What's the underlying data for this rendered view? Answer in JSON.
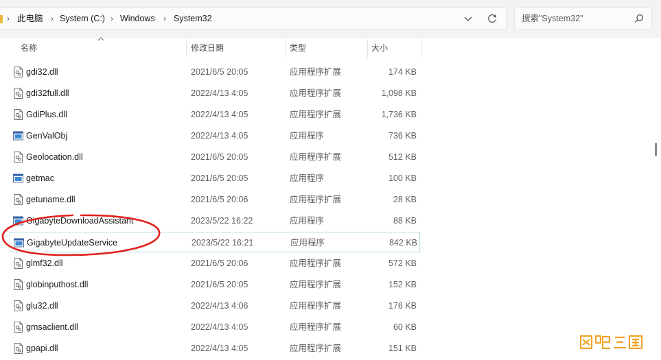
{
  "address_bar": {
    "crumbs": [
      "此电脑",
      "System (C:)",
      "Windows",
      "System32"
    ]
  },
  "search": {
    "placeholder": "搜索\"System32\""
  },
  "columns": {
    "name": "名称",
    "date": "修改日期",
    "type": "类型",
    "size": "大小"
  },
  "files": [
    {
      "name": "gdi32.dll",
      "date": "2021/6/5 20:05",
      "type": "应用程序扩展",
      "size": "174 KB",
      "icon": "dll-file-icon"
    },
    {
      "name": "gdi32full.dll",
      "date": "2022/4/13 4:05",
      "type": "应用程序扩展",
      "size": "1,098 KB",
      "icon": "dll-file-icon"
    },
    {
      "name": "GdiPlus.dll",
      "date": "2022/4/13 4:05",
      "type": "应用程序扩展",
      "size": "1,736 KB",
      "icon": "dll-file-icon"
    },
    {
      "name": "GenValObj",
      "date": "2022/4/13 4:05",
      "type": "应用程序",
      "size": "736 KB",
      "icon": "exe-file-icon"
    },
    {
      "name": "Geolocation.dll",
      "date": "2021/6/5 20:05",
      "type": "应用程序扩展",
      "size": "512 KB",
      "icon": "dll-file-icon"
    },
    {
      "name": "getmac",
      "date": "2021/6/5 20:05",
      "type": "应用程序",
      "size": "100 KB",
      "icon": "exe-file-icon"
    },
    {
      "name": "getuname.dll",
      "date": "2021/6/5 20:06",
      "type": "应用程序扩展",
      "size": "28 KB",
      "icon": "dll-file-icon"
    },
    {
      "name": "GigabyteDownloadAssistant",
      "date": "2023/5/22 16:22",
      "type": "应用程序",
      "size": "88 KB",
      "icon": "exe-file-icon"
    },
    {
      "name": "GigabyteUpdateService",
      "date": "2023/5/22 16:21",
      "type": "应用程序",
      "size": "842 KB",
      "icon": "exe-file-icon",
      "selected": true
    },
    {
      "name": "glmf32.dll",
      "date": "2021/6/5 20:06",
      "type": "应用程序扩展",
      "size": "572 KB",
      "icon": "dll-file-icon"
    },
    {
      "name": "globinputhost.dll",
      "date": "2021/6/5 20:05",
      "type": "应用程序扩展",
      "size": "152 KB",
      "icon": "dll-file-icon"
    },
    {
      "name": "glu32.dll",
      "date": "2022/4/13 4:06",
      "type": "应用程序扩展",
      "size": "176 KB",
      "icon": "dll-file-icon"
    },
    {
      "name": "gmsaclient.dll",
      "date": "2022/4/13 4:05",
      "type": "应用程序扩展",
      "size": "60 KB",
      "icon": "dll-file-icon"
    },
    {
      "name": "gpapi.dll",
      "date": "2022/4/13 4:05",
      "type": "应用程序扩展",
      "size": "151 KB",
      "icon": "dll-file-icon"
    }
  ],
  "colors": {
    "annotation": "#e0201b",
    "selection_border": "#b8dcdf",
    "watermark": "#f0a52a"
  }
}
